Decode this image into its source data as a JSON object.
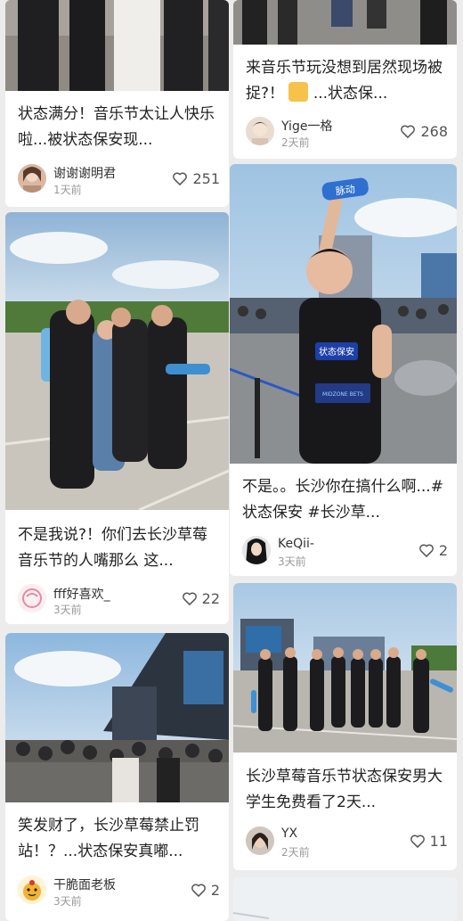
{
  "feed": {
    "cards": [
      {
        "title": "状态满分！音乐节太让人快乐啦...被状态保安现...",
        "author": "谢谢谢明君",
        "time": "1天前",
        "likes": "251"
      },
      {
        "title": "来音乐节玩没想到居然现场被捉?！",
        "title_tail": "...状态保...",
        "author": "Yige一格",
        "time": "2天前",
        "likes": "268"
      },
      {
        "title": "不是我说?！你们去长沙草莓音乐节的人嘴那么 这...",
        "author": "fff好喜欢_",
        "time": "3天前",
        "likes": "22",
        "image_text": {
          "bottle": ""
        }
      },
      {
        "title": "不是。。长沙你在搞什么啊...#状态保安 #长沙草...",
        "author": "KeQii-",
        "time": "3天前",
        "likes": "2",
        "image_text": {
          "bottle": "脉动",
          "vest": "状态保安",
          "vest_small": "MIDZONE BETS"
        }
      },
      {
        "title": "笑发财了，长沙草莓禁止罚站！？...状态保安真嘟...",
        "author": "干脆面老板",
        "time": "3天前",
        "likes": "2"
      },
      {
        "title": "长沙草莓音乐节状态保安男大学生免费看了2天...",
        "author": "YX",
        "time": "2天前",
        "likes": "11"
      }
    ]
  },
  "icons": {
    "like": "heart-outline-icon",
    "reaction": "scared-face-emoji-icon"
  },
  "colors": {
    "background": "#ececec",
    "card": "#ffffff",
    "text": "#222222",
    "meta": "#999999"
  }
}
